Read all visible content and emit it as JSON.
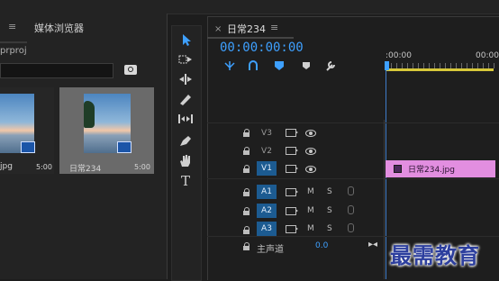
{
  "project_panel": {
    "menu_icon": "≡",
    "tab_label": "媒体浏览器",
    "path_fragment": "prproj",
    "clips": [
      {
        "name": "jpg",
        "duration": "5:00"
      },
      {
        "name": "日常234",
        "duration": "5:00"
      }
    ]
  },
  "tools": [
    "selection-tool",
    "track-select-tool",
    "ripple-edit-tool",
    "razor-tool",
    "slip-tool",
    "pen-tool",
    "hand-tool",
    "type-tool"
  ],
  "tools_type_label": "T",
  "timeline": {
    "close": "×",
    "sequence_title": "日常234",
    "menu_icon": "≡",
    "timecode": "00:00:00:00",
    "ruler_start": ":00:00",
    "ruler_next": "00:00",
    "tracks": [
      {
        "label": "V3",
        "type": "video",
        "active": false
      },
      {
        "label": "V2",
        "type": "video",
        "active": false
      },
      {
        "label": "V1",
        "type": "video",
        "active": true
      },
      {
        "label": "A1",
        "type": "audio",
        "active": true
      },
      {
        "label": "A2",
        "type": "audio",
        "active": true
      },
      {
        "label": "A3",
        "type": "audio",
        "active": true
      }
    ],
    "audio_buttons": {
      "mute": "M",
      "solo": "S"
    },
    "master": {
      "label": "主声道",
      "value": "0.0"
    },
    "clip_v1": "日常234.jpg"
  },
  "watermark": "最需教育",
  "colors": {
    "accent": "#3ea0ff",
    "clip": "#e28ee0",
    "track_active": "#1c5b91"
  }
}
